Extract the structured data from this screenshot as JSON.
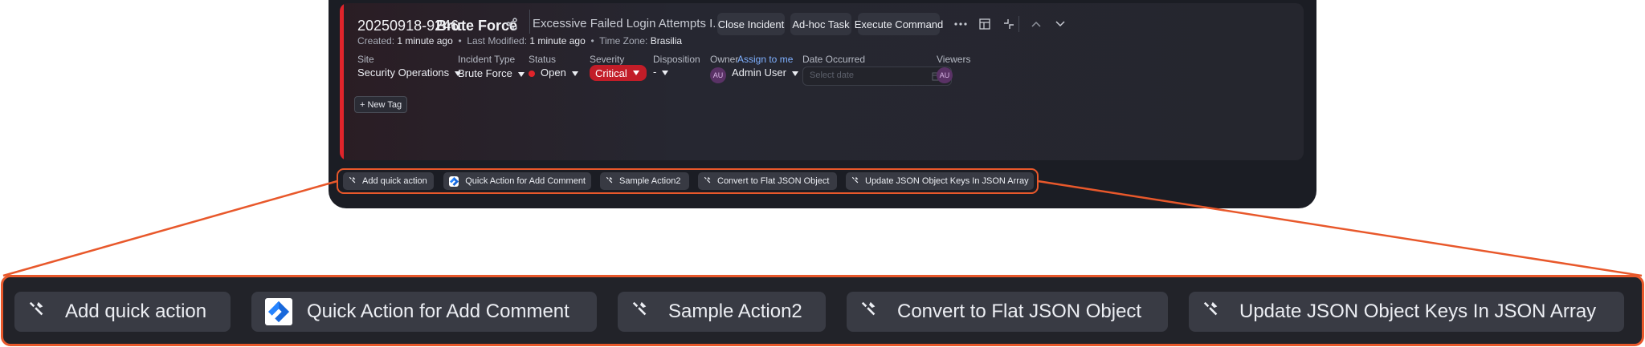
{
  "incident": {
    "id": "20250918-9246:",
    "name": "Brute Force",
    "description": "Excessive Failed Login Attempts I...",
    "created_label": "Created:",
    "created_value": "1 minute ago",
    "modified_label": "Last Modified:",
    "modified_value": "1 minute ago",
    "timezone_label": "Time Zone:",
    "timezone_value": "Brasilia"
  },
  "actions": {
    "close": "Close Incident",
    "adhoc": "Ad-hoc Task",
    "execute": "Execute Command"
  },
  "fields": {
    "site_label": "Site",
    "site_value": "Security Operations",
    "type_label": "Incident Type",
    "type_value": "Brute Force",
    "status_label": "Status",
    "status_value": "Open",
    "severity_label": "Severity",
    "severity_value": "Critical",
    "disposition_label": "Disposition",
    "disposition_value": "-",
    "owner_label": "Owner",
    "assign_link": "Assign to me",
    "owner_initials": "AU",
    "owner_value": "Admin User",
    "date_label": "Date Occurred",
    "date_placeholder": "Select date",
    "viewers_label": "Viewers",
    "viewer_initials": "AU"
  },
  "tag": {
    "new_tag": "+ New Tag"
  },
  "quick_actions": [
    {
      "label": "Add quick action",
      "icon": "wrench-icon"
    },
    {
      "label": "Quick Action for Add Comment",
      "icon": "jira-icon"
    },
    {
      "label": "Sample Action2",
      "icon": "wrench-icon"
    },
    {
      "label": "Convert to Flat JSON Object",
      "icon": "wrench-icon"
    },
    {
      "label": "Update JSON Object Keys In JSON Array",
      "icon": "wrench-icon"
    }
  ],
  "colors": {
    "accent_orange": "#e8582b",
    "severity_red": "#c21d28",
    "status_dot": "#e0242b",
    "link_blue": "#7fb0ff"
  }
}
